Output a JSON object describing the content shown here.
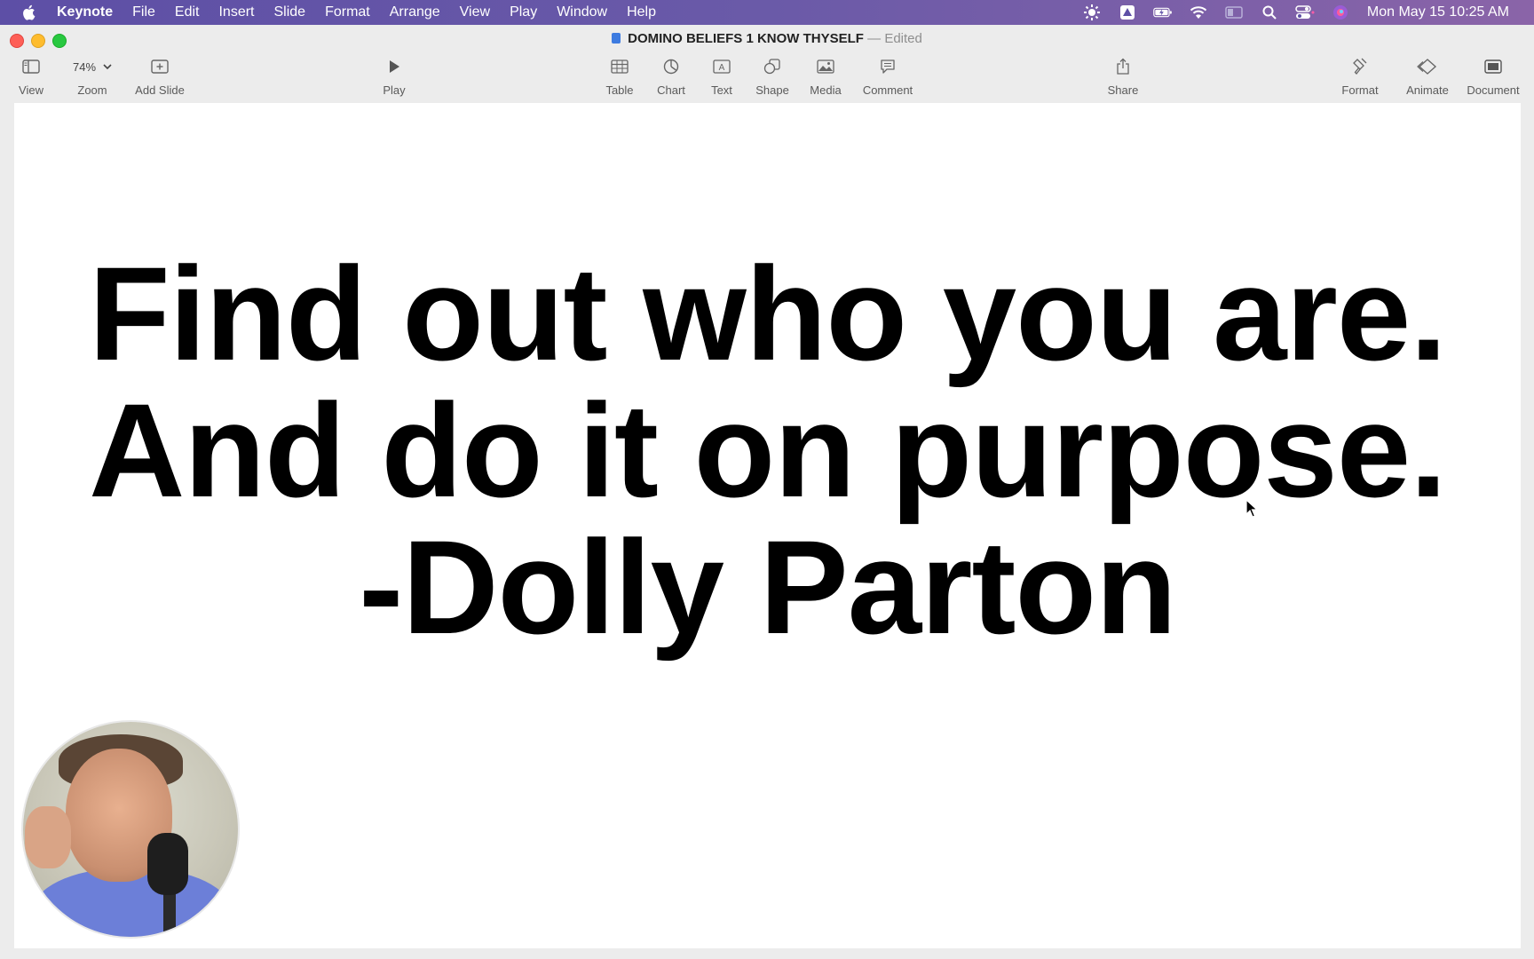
{
  "menubar": {
    "app_name": "Keynote",
    "menus": [
      "File",
      "Edit",
      "Insert",
      "Slide",
      "Format",
      "Arrange",
      "View",
      "Play",
      "Window",
      "Help"
    ],
    "clock": "Mon May 15  10:25 AM"
  },
  "window": {
    "title": "DOMINO BELIEFS 1 KNOW THYSELF",
    "title_separator": "—",
    "edited_label": "Edited"
  },
  "toolbar": {
    "view_label": "View",
    "zoom_value": "74%",
    "zoom_label": "Zoom",
    "add_slide_label": "Add Slide",
    "play_label": "Play",
    "table_label": "Table",
    "chart_label": "Chart",
    "text_label": "Text",
    "shape_label": "Shape",
    "media_label": "Media",
    "comment_label": "Comment",
    "share_label": "Share",
    "format_label": "Format",
    "animate_label": "Animate",
    "document_label": "Document"
  },
  "slide": {
    "lines": [
      "Find out who you are.",
      "And do it on purpose.",
      "-Dolly Parton"
    ]
  },
  "colors": {
    "menubar_bg": "#5d4fa6",
    "window_bg": "#ececec",
    "slide_bg": "#ffffff",
    "slide_text": "#000000"
  }
}
